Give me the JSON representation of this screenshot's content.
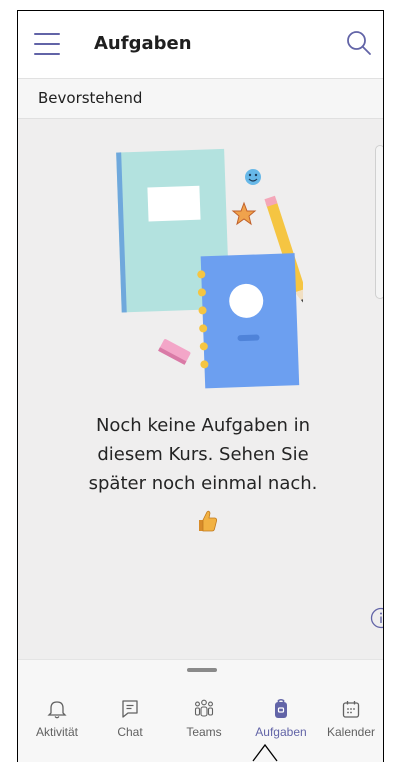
{
  "header": {
    "title": "Aufgaben"
  },
  "subheader": {
    "label": "Bevorstehend"
  },
  "empty_state": {
    "line1": "Noch keine Aufgaben in",
    "line2": "diesem Kurs. Sehen Sie",
    "line3": "später noch einmal nach.",
    "emoji": "thumbs-up"
  },
  "tabs": [
    {
      "label": "Aktivität",
      "icon": "bell-icon",
      "active": false
    },
    {
      "label": "Chat",
      "icon": "chat-icon",
      "active": false
    },
    {
      "label": "Teams",
      "icon": "teams-icon",
      "active": false
    },
    {
      "label": "Aufgaben",
      "icon": "assignments-icon",
      "active": true
    },
    {
      "label": "Kalender",
      "icon": "calendar-icon",
      "active": false
    }
  ],
  "colors": {
    "accent": "#6264a7",
    "background": "#efeeee",
    "notebook_teal": "#b3e2df",
    "notebook_blue": "#6c9ff0",
    "pencil": "#f5c542",
    "eraser": "#f3a6c8",
    "star": "#f0a24c",
    "smiley": "#67b8e8"
  }
}
